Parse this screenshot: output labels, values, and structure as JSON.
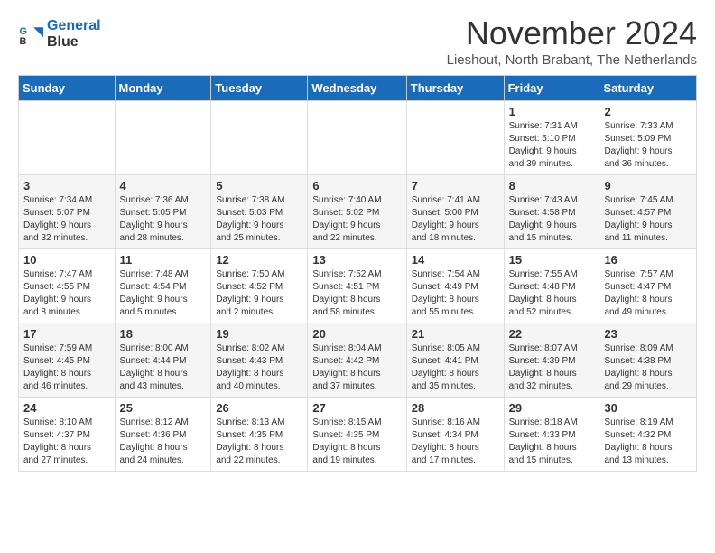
{
  "logo": {
    "line1": "General",
    "line2": "Blue"
  },
  "header": {
    "month": "November 2024",
    "location": "Lieshout, North Brabant, The Netherlands"
  },
  "weekdays": [
    "Sunday",
    "Monday",
    "Tuesday",
    "Wednesday",
    "Thursday",
    "Friday",
    "Saturday"
  ],
  "weeks": [
    [
      {
        "day": "",
        "info": ""
      },
      {
        "day": "",
        "info": ""
      },
      {
        "day": "",
        "info": ""
      },
      {
        "day": "",
        "info": ""
      },
      {
        "day": "",
        "info": ""
      },
      {
        "day": "1",
        "info": "Sunrise: 7:31 AM\nSunset: 5:10 PM\nDaylight: 9 hours\nand 39 minutes."
      },
      {
        "day": "2",
        "info": "Sunrise: 7:33 AM\nSunset: 5:09 PM\nDaylight: 9 hours\nand 36 minutes."
      }
    ],
    [
      {
        "day": "3",
        "info": "Sunrise: 7:34 AM\nSunset: 5:07 PM\nDaylight: 9 hours\nand 32 minutes."
      },
      {
        "day": "4",
        "info": "Sunrise: 7:36 AM\nSunset: 5:05 PM\nDaylight: 9 hours\nand 28 minutes."
      },
      {
        "day": "5",
        "info": "Sunrise: 7:38 AM\nSunset: 5:03 PM\nDaylight: 9 hours\nand 25 minutes."
      },
      {
        "day": "6",
        "info": "Sunrise: 7:40 AM\nSunset: 5:02 PM\nDaylight: 9 hours\nand 22 minutes."
      },
      {
        "day": "7",
        "info": "Sunrise: 7:41 AM\nSunset: 5:00 PM\nDaylight: 9 hours\nand 18 minutes."
      },
      {
        "day": "8",
        "info": "Sunrise: 7:43 AM\nSunset: 4:58 PM\nDaylight: 9 hours\nand 15 minutes."
      },
      {
        "day": "9",
        "info": "Sunrise: 7:45 AM\nSunset: 4:57 PM\nDaylight: 9 hours\nand 11 minutes."
      }
    ],
    [
      {
        "day": "10",
        "info": "Sunrise: 7:47 AM\nSunset: 4:55 PM\nDaylight: 9 hours\nand 8 minutes."
      },
      {
        "day": "11",
        "info": "Sunrise: 7:48 AM\nSunset: 4:54 PM\nDaylight: 9 hours\nand 5 minutes."
      },
      {
        "day": "12",
        "info": "Sunrise: 7:50 AM\nSunset: 4:52 PM\nDaylight: 9 hours\nand 2 minutes."
      },
      {
        "day": "13",
        "info": "Sunrise: 7:52 AM\nSunset: 4:51 PM\nDaylight: 8 hours\nand 58 minutes."
      },
      {
        "day": "14",
        "info": "Sunrise: 7:54 AM\nSunset: 4:49 PM\nDaylight: 8 hours\nand 55 minutes."
      },
      {
        "day": "15",
        "info": "Sunrise: 7:55 AM\nSunset: 4:48 PM\nDaylight: 8 hours\nand 52 minutes."
      },
      {
        "day": "16",
        "info": "Sunrise: 7:57 AM\nSunset: 4:47 PM\nDaylight: 8 hours\nand 49 minutes."
      }
    ],
    [
      {
        "day": "17",
        "info": "Sunrise: 7:59 AM\nSunset: 4:45 PM\nDaylight: 8 hours\nand 46 minutes."
      },
      {
        "day": "18",
        "info": "Sunrise: 8:00 AM\nSunset: 4:44 PM\nDaylight: 8 hours\nand 43 minutes."
      },
      {
        "day": "19",
        "info": "Sunrise: 8:02 AM\nSunset: 4:43 PM\nDaylight: 8 hours\nand 40 minutes."
      },
      {
        "day": "20",
        "info": "Sunrise: 8:04 AM\nSunset: 4:42 PM\nDaylight: 8 hours\nand 37 minutes."
      },
      {
        "day": "21",
        "info": "Sunrise: 8:05 AM\nSunset: 4:41 PM\nDaylight: 8 hours\nand 35 minutes."
      },
      {
        "day": "22",
        "info": "Sunrise: 8:07 AM\nSunset: 4:39 PM\nDaylight: 8 hours\nand 32 minutes."
      },
      {
        "day": "23",
        "info": "Sunrise: 8:09 AM\nSunset: 4:38 PM\nDaylight: 8 hours\nand 29 minutes."
      }
    ],
    [
      {
        "day": "24",
        "info": "Sunrise: 8:10 AM\nSunset: 4:37 PM\nDaylight: 8 hours\nand 27 minutes."
      },
      {
        "day": "25",
        "info": "Sunrise: 8:12 AM\nSunset: 4:36 PM\nDaylight: 8 hours\nand 24 minutes."
      },
      {
        "day": "26",
        "info": "Sunrise: 8:13 AM\nSunset: 4:35 PM\nDaylight: 8 hours\nand 22 minutes."
      },
      {
        "day": "27",
        "info": "Sunrise: 8:15 AM\nSunset: 4:35 PM\nDaylight: 8 hours\nand 19 minutes."
      },
      {
        "day": "28",
        "info": "Sunrise: 8:16 AM\nSunset: 4:34 PM\nDaylight: 8 hours\nand 17 minutes."
      },
      {
        "day": "29",
        "info": "Sunrise: 8:18 AM\nSunset: 4:33 PM\nDaylight: 8 hours\nand 15 minutes."
      },
      {
        "day": "30",
        "info": "Sunrise: 8:19 AM\nSunset: 4:32 PM\nDaylight: 8 hours\nand 13 minutes."
      }
    ]
  ]
}
